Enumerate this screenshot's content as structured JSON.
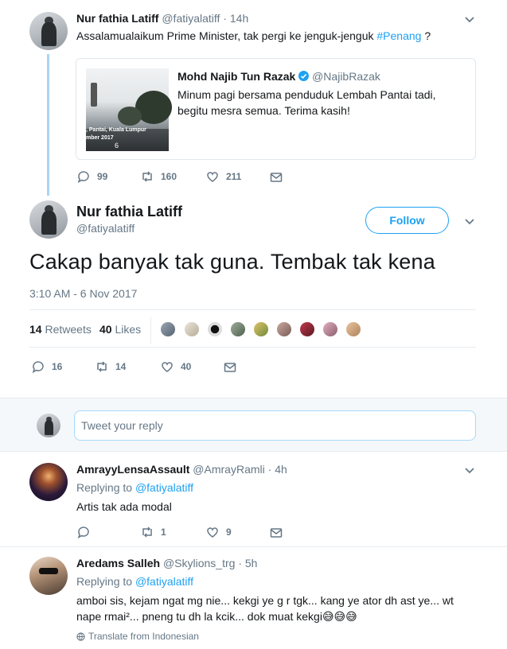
{
  "parent_tweet": {
    "name": "Nur fathia Latiff",
    "handle": "@fatiyalatiff",
    "time": "· 14h",
    "text_before": "Assalamualaikum Prime Minister, tak pergi ke jenguk-jenguk ",
    "hashtag": "#Penang",
    "text_after": " ?",
    "quote": {
      "name": "Mohd Najib Tun Razak",
      "handle": "@NajibRazak",
      "text": "Minum pagi bersama penduduk Lembah Pantai tadi, begitu mesra semua. Terima kasih!",
      "image_caption_line1": ", Pantai, Kuala Lumpur",
      "image_caption_line2": "mber 2017",
      "image_caption_badge": "6"
    },
    "actions": {
      "replies": "99",
      "retweets": "160",
      "likes": "211"
    }
  },
  "main_tweet": {
    "name": "Nur fathia Latiff",
    "handle": "@fatiyalatiff",
    "follow_label": "Follow",
    "text": "Cakap banyak tak guna. Tembak tak kena",
    "timestamp": "3:10 AM - 6 Nov 2017",
    "retweets_count": "14",
    "retweets_label": "Retweets",
    "likes_count": "40",
    "likes_label": "Likes",
    "actions": {
      "replies": "16",
      "retweets": "14",
      "likes": "40"
    }
  },
  "reply_composer": {
    "placeholder": "Tweet your reply"
  },
  "replies": [
    {
      "name": "AmrayyLensaAssault",
      "handle": "@AmrayRamli",
      "time": "· 4h",
      "replying_label": "Replying to",
      "replying_handle": "@fatiyalatiff",
      "text": "Artis tak ada modal",
      "actions": {
        "replies": "",
        "retweets": "1",
        "likes": "9"
      }
    },
    {
      "name": "Aredams Salleh",
      "handle": "@Skylions_trg",
      "time": "· 5h",
      "replying_label": "Replying to",
      "replying_handle": "@fatiyalatiff",
      "text_line1": "amboi sis, kejam ngat mg nie... kekgi ye g r tgk... kang ye ator dh ast ye... wt",
      "text_line2": "nape rmai²... pneng tu dh la kcik... dok muat kekgi",
      "emoji": "😅😅😅",
      "translate_label": "Translate from Indonesian"
    }
  ],
  "colors": {
    "accent": "#1da1f2",
    "muted": "#657786",
    "thread_line": "#a8d6f5"
  }
}
